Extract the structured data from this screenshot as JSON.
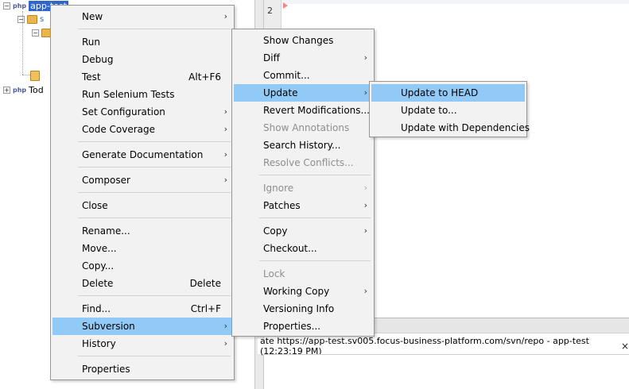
{
  "tree": {
    "project_badge": "php",
    "project_name": "app-test",
    "folder_child": "s",
    "sibling_badge": "php",
    "sibling_project": "Tod"
  },
  "editor": {
    "line_number": "2"
  },
  "output": {
    "tab_text": "ate https://app-test.sv005.focus-business-platform.com/svn/repo - app-test (12:23:19 PM)",
    "close_glyph": "×"
  },
  "context_menu": {
    "items": [
      {
        "label": "New",
        "submenu": true
      },
      {
        "label": "Run"
      },
      {
        "label": "Debug"
      },
      {
        "label": "Test",
        "accelerator": "Alt+F6"
      },
      {
        "label": "Run Selenium Tests"
      },
      {
        "label": "Set Configuration",
        "submenu": true
      },
      {
        "label": "Code Coverage",
        "submenu": true
      },
      {
        "label": "Generate Documentation",
        "submenu": true
      },
      {
        "label": "Composer",
        "submenu": true
      },
      {
        "label": "Close"
      },
      {
        "label": "Rename..."
      },
      {
        "label": "Move..."
      },
      {
        "label": "Copy..."
      },
      {
        "label": "Delete",
        "accelerator": "Delete"
      },
      {
        "label": "Find...",
        "accelerator": "Ctrl+F"
      },
      {
        "label": "Subversion",
        "submenu": true,
        "selected": true
      },
      {
        "label": "History",
        "submenu": true
      },
      {
        "label": "Properties"
      }
    ]
  },
  "subversion_menu": {
    "items": [
      {
        "label": "Show Changes"
      },
      {
        "label": "Diff",
        "submenu": true
      },
      {
        "label": "Commit..."
      },
      {
        "label": "Update",
        "submenu": true,
        "selected": true
      },
      {
        "label": "Revert Modifications..."
      },
      {
        "label": "Show Annotations",
        "disabled": true
      },
      {
        "label": "Search History..."
      },
      {
        "label": "Resolve Conflicts...",
        "disabled": true
      },
      {
        "label": "Ignore",
        "submenu": true,
        "disabled": true
      },
      {
        "label": "Patches",
        "submenu": true
      },
      {
        "label": "Copy",
        "submenu": true
      },
      {
        "label": "Checkout..."
      },
      {
        "label": "Lock",
        "disabled": true
      },
      {
        "label": "Working Copy",
        "submenu": true
      },
      {
        "label": "Versioning Info"
      },
      {
        "label": "Properties..."
      }
    ]
  },
  "update_menu": {
    "items": [
      {
        "label": "Update to HEAD",
        "selected": true
      },
      {
        "label": "Update to..."
      },
      {
        "label": "Update with Dependencies"
      }
    ]
  },
  "glyphs": {
    "submenu_arrow": "›",
    "expander_minus": "−",
    "expander_plus": "+"
  },
  "colors": {
    "menu_background": "#f2f2f2",
    "selection_highlight": "#91c9f7",
    "tree_selection": "#2f65ca",
    "disabled_text": "#8e8e8e"
  }
}
